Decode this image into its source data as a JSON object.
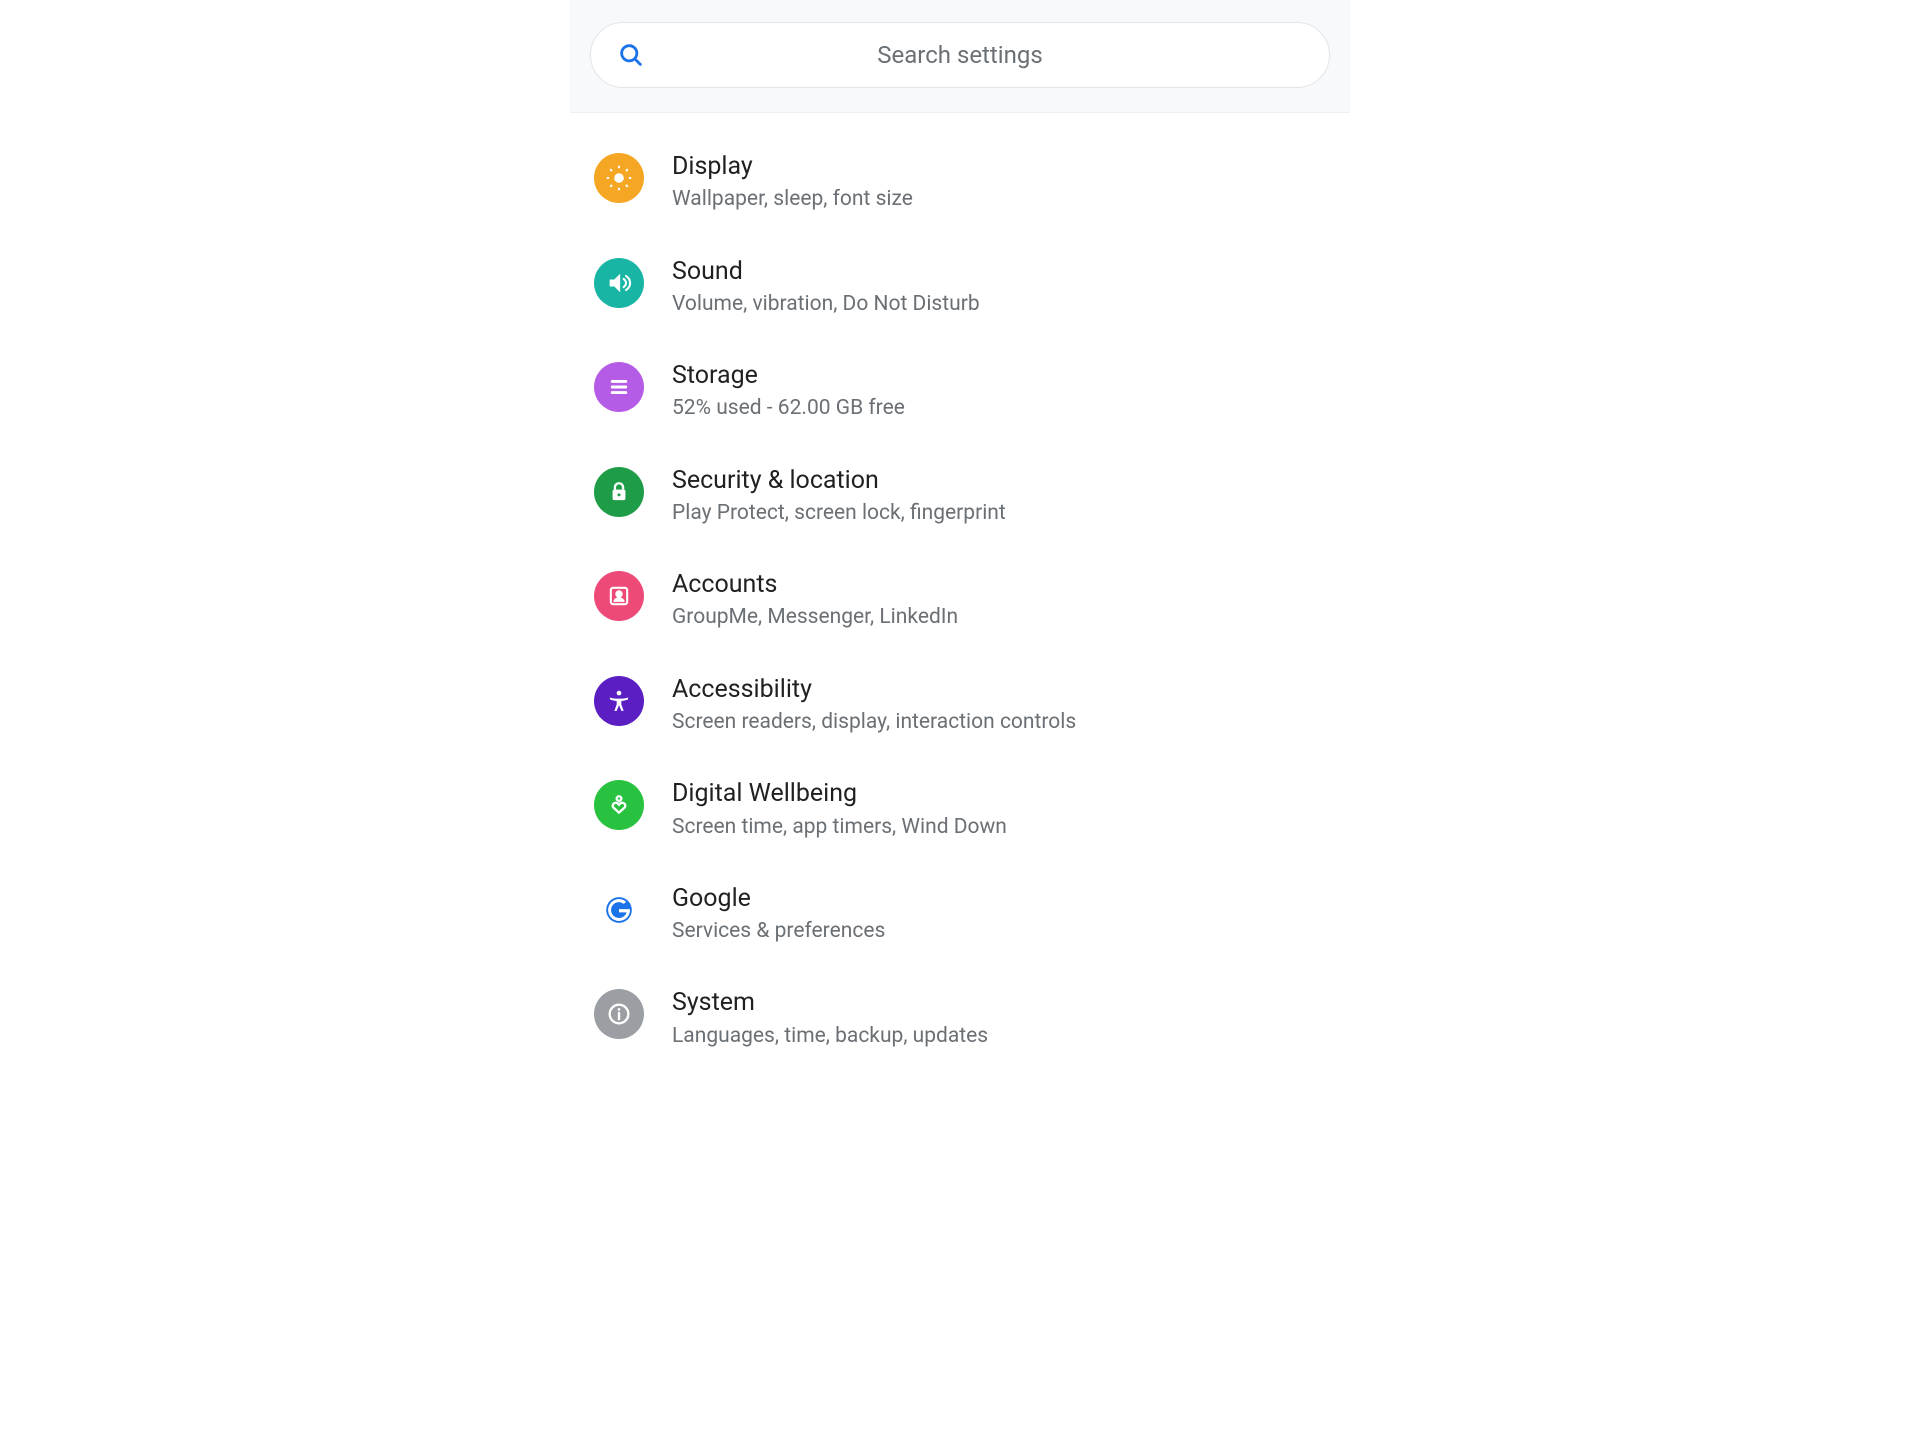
{
  "search": {
    "placeholder": "Search settings"
  },
  "items": [
    {
      "key": "display",
      "title": "Display",
      "subtitle": "Wallpaper, sleep, font size"
    },
    {
      "key": "sound",
      "title": "Sound",
      "subtitle": "Volume, vibration, Do Not Disturb"
    },
    {
      "key": "storage",
      "title": "Storage",
      "subtitle": "52% used - 62.00 GB free"
    },
    {
      "key": "security",
      "title": "Security & location",
      "subtitle": "Play Protect, screen lock, fingerprint"
    },
    {
      "key": "accounts",
      "title": "Accounts",
      "subtitle": "GroupMe, Messenger, LinkedIn"
    },
    {
      "key": "accessibility",
      "title": "Accessibility",
      "subtitle": "Screen readers, display, interaction controls"
    },
    {
      "key": "wellbeing",
      "title": "Digital Wellbeing",
      "subtitle": "Screen time, app timers, Wind Down"
    },
    {
      "key": "google",
      "title": "Google",
      "subtitle": "Services & preferences"
    },
    {
      "key": "system",
      "title": "System",
      "subtitle": "Languages, time, backup, updates"
    }
  ]
}
